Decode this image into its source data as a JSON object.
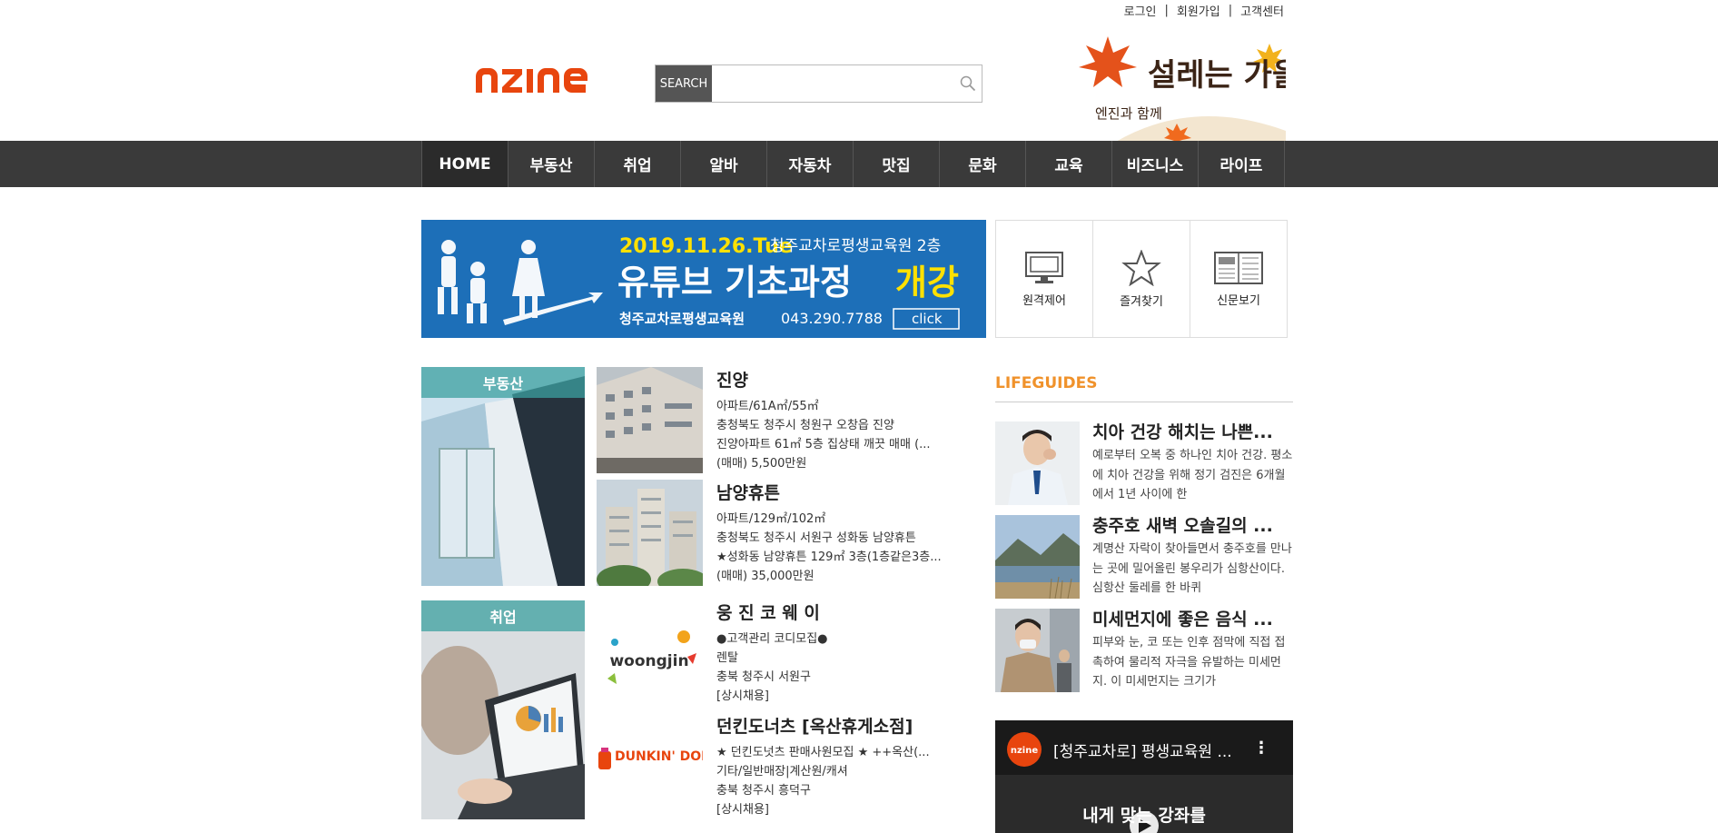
{
  "header": {
    "links": [
      "로그인",
      "회원가입",
      "고객센터"
    ],
    "logo_text": "nzine",
    "search_label": "SEARCH",
    "search_placeholder": ""
  },
  "autumn_banner": {
    "title": "설레는 가을",
    "subtitle": "엔진과 함께"
  },
  "nav": {
    "items": [
      "HOME",
      "부동산",
      "취업",
      "알바",
      "자동차",
      "맛집",
      "문화",
      "교육",
      "비즈니스",
      "라이프"
    ]
  },
  "main_banner": {
    "date": "2019.11.26.Tue",
    "place": "청주교차로평생교육원 2층",
    "headline": "유튜브 기초과정",
    "highlight": "개강",
    "org": "청주교차로평생교육원",
    "phone": "043.290.7788",
    "button": "click"
  },
  "quick_menu": [
    {
      "label": "원격제어",
      "icon": "monitor-icon"
    },
    {
      "label": "즐겨찾기",
      "icon": "star-icon"
    },
    {
      "label": "신문보기",
      "icon": "newspaper-icon"
    }
  ],
  "realestate": {
    "category": "부동산",
    "listings": [
      {
        "title": "진양",
        "lines": [
          "아파트/61A㎡/55㎡",
          "충청북도 청주시 청원구 오창읍 진양",
          "진양아파트 61㎡ 5층 집상태 깨끗 매매 (...",
          "(매매) 5,500만원"
        ]
      },
      {
        "title": "남양휴튼",
        "lines": [
          "아파트/129㎡/102㎡",
          "충청북도 청주시 서원구 성화동 남양휴튼",
          "★성화동 남양휴튼 129㎡ 3층(1층같은3층...",
          "(매매) 35,000만원"
        ]
      }
    ]
  },
  "jobs": {
    "category": "취업",
    "listings": [
      {
        "title": "웅 진 코 웨 이",
        "logo": "woongjin",
        "lines": [
          "●고객관리 코디모집●",
          "렌탈",
          "충북 청주시 서원구",
          "[상시채용]"
        ]
      },
      {
        "title": "던킨도너츠 [옥산휴게소점]",
        "logo": "DUNKIN' DONUTS",
        "lines": [
          "★ 던킨도넛츠 판매사원모집 ★ ++옥산(...",
          "기타/일반매장|계산원/캐셔",
          "충북 청주시 흥덕구",
          "[상시채용]"
        ]
      }
    ]
  },
  "lifeguides": {
    "title": "LIFEGUIDES",
    "items": [
      {
        "title": "치아 건강 해치는 나쁜...",
        "desc": "예로부터 오복 중 하나인 치아 건강. 평소에 치아 건강을 위해 정기 검진은 6개월에서 1년 사이에 한"
      },
      {
        "title": "충주호 새벽 오솔길의 ...",
        "desc": "계명산 자락이 찾아들면서 충주호를 만나는 곳에 밀어올린 봉우리가 심항산이다. 심항산 둘레를 한 바퀴"
      },
      {
        "title": "미세먼지에 좋은 음식 ...",
        "desc": "피부와 눈, 코 또는 인후 점막에 직접 접촉하여 물리적 자극을 유발하는 미세먼지. 이 미세먼지는 크기가"
      }
    ]
  },
  "video": {
    "title": "[청주교차로] 평생교육원 ...",
    "caption": "내게 맞는 강좌를",
    "channel_badge": "nzine"
  },
  "colors": {
    "brand": "#e8450e",
    "nav_bg": "#3a3a3a",
    "accent": "#f0922b",
    "banner_blue": "#1d6fb8",
    "banner_yellow": "#ffe100"
  }
}
